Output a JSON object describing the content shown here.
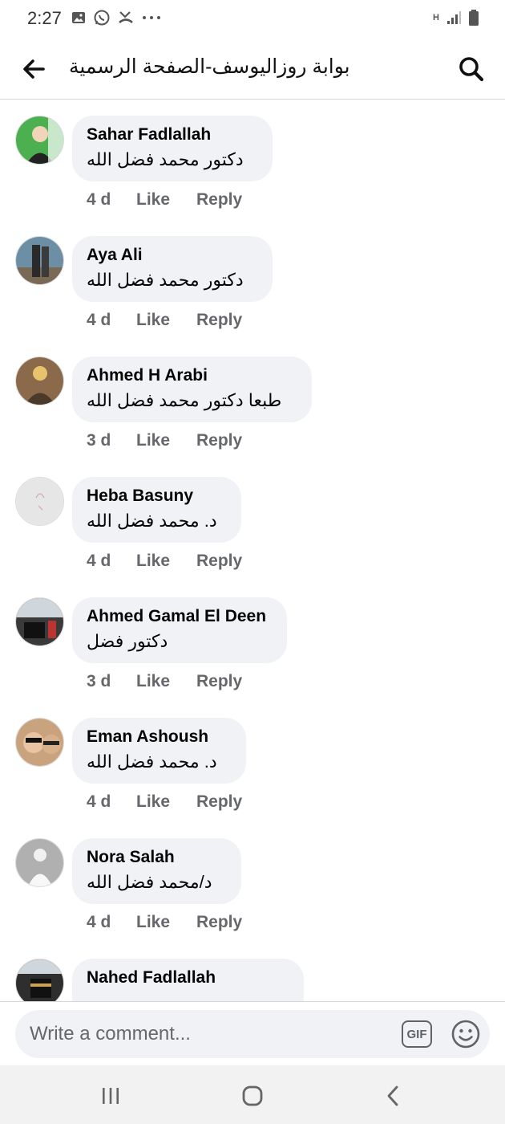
{
  "status_bar": {
    "time": "2:27",
    "network": "H"
  },
  "header": {
    "title": "بوابة روزاليوسف-الصفحة الرسمية"
  },
  "comments": [
    {
      "author": "Sahar Fadlallah",
      "text": "دكتور محمد فضل الله",
      "time": "4 d",
      "like": "Like",
      "reply": "Reply",
      "avatar_color": "#4caf50"
    },
    {
      "author": "Aya Ali",
      "text": "دكتور محمد فضل الله",
      "time": "4 d",
      "like": "Like",
      "reply": "Reply",
      "avatar_color": "#6d8fa6"
    },
    {
      "author": "Ahmed H Arabi",
      "text": "طبعا دكتور محمد فضل الله",
      "time": "3 d",
      "like": "Like",
      "reply": "Reply",
      "avatar_color": "#8a6a4a"
    },
    {
      "author": "Heba Basuny",
      "text": "د. محمد فضل الله",
      "time": "4 d",
      "like": "Like",
      "reply": "Reply",
      "avatar_color": "#e6e6e6"
    },
    {
      "author": "Ahmed Gamal El Deen",
      "text": "دكتور فضل",
      "time": "3 d",
      "like": "Like",
      "reply": "Reply",
      "avatar_color": "#3a3a3a"
    },
    {
      "author": "Eman Ashoush",
      "text": "د. محمد فضل الله",
      "time": "4 d",
      "like": "Like",
      "reply": "Reply",
      "avatar_color": "#c9a27e"
    },
    {
      "author": "Nora Salah",
      "text": "د/محمد فضل الله",
      "time": "4 d",
      "like": "Like",
      "reply": "Reply",
      "avatar_color": "#b0b0b0"
    },
    {
      "author": "Nahed Fadlallah",
      "text": "",
      "time": "",
      "like": "",
      "reply": "",
      "avatar_color": "#2e2e2e"
    }
  ],
  "composer": {
    "placeholder": "Write a comment...",
    "gif_label": "GIF"
  },
  "colors": {
    "bubble": "#f0f2f5",
    "meta": "#65676b",
    "text": "#050505"
  },
  "icons": {
    "back": "arrow-left-icon",
    "search": "search-icon",
    "emoji": "smiley-icon",
    "nav_recent": "recent-apps-icon",
    "nav_home": "home-icon",
    "nav_back": "chevron-left-icon"
  }
}
